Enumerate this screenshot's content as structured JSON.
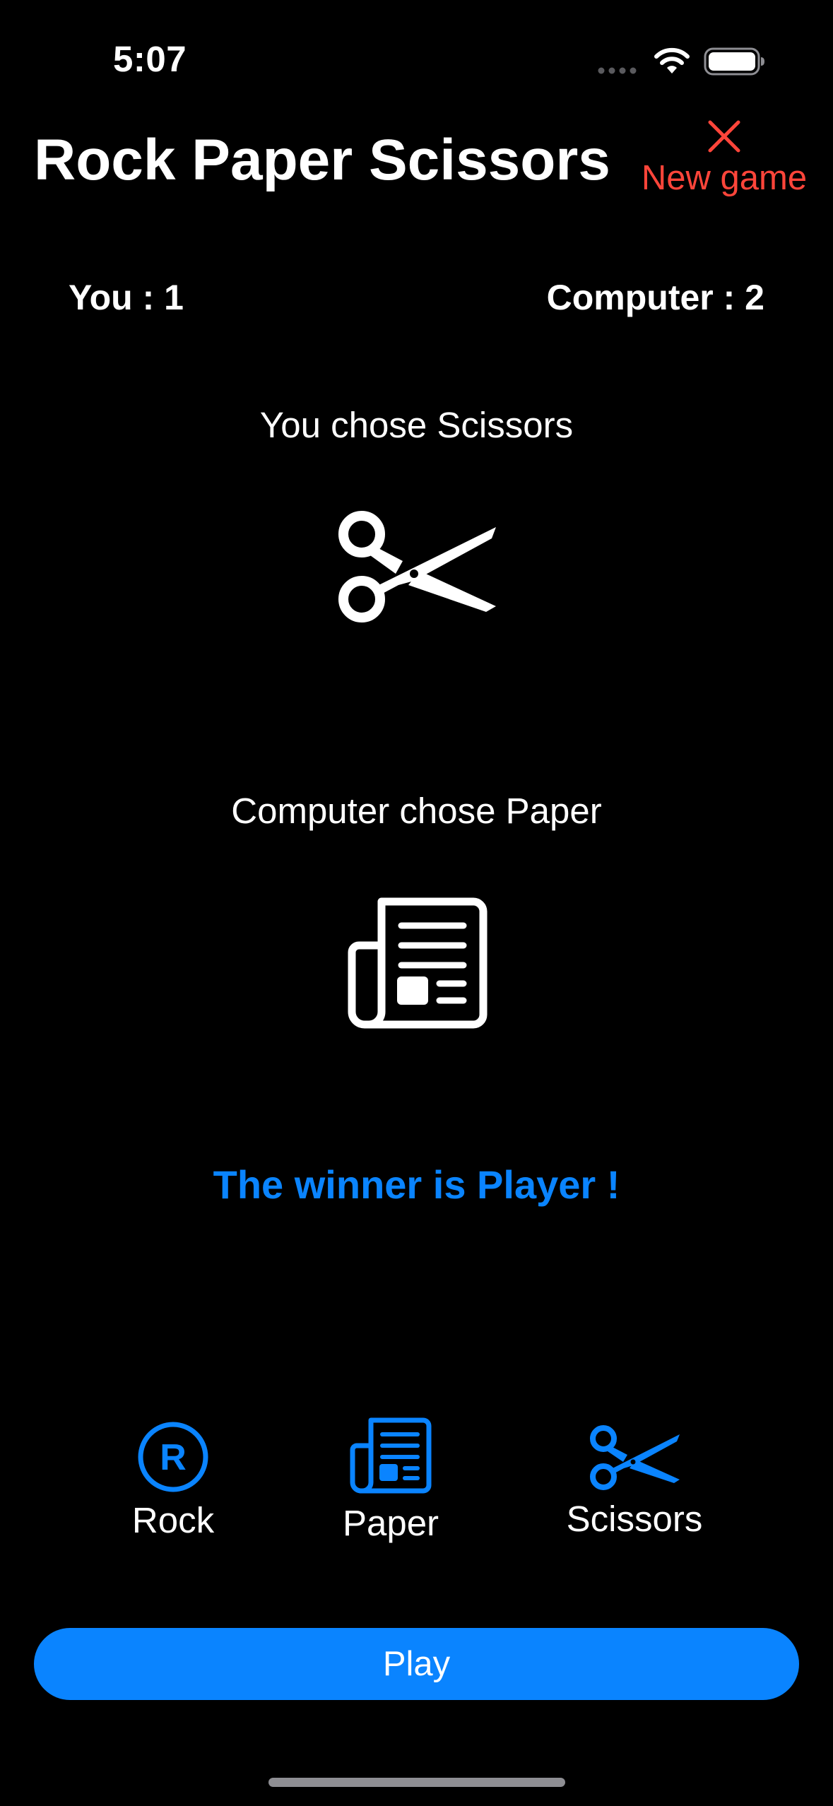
{
  "status_bar": {
    "time": "5:07"
  },
  "header": {
    "title": "Rock Paper Scissors",
    "new_game_label": "New game"
  },
  "scores": {
    "you_label": "You : 1",
    "computer_label": "Computer : 2"
  },
  "round": {
    "player_choice_text": "You chose Scissors",
    "player_choice_icon": "scissors-icon",
    "computer_choice_text": "Computer chose Paper",
    "computer_choice_icon": "newspaper-icon",
    "winner_text": "The winner is Player !"
  },
  "options": [
    {
      "label": "Rock",
      "icon": "r-circle-icon"
    },
    {
      "label": "Paper",
      "icon": "newspaper-icon"
    },
    {
      "label": "Scissors",
      "icon": "scissors-icon"
    }
  ],
  "play_button": {
    "label": "Play"
  },
  "colors": {
    "background": "#000000",
    "accent_blue": "#0a84ff",
    "destructive_red": "#ff453a",
    "text": "#ffffff"
  }
}
